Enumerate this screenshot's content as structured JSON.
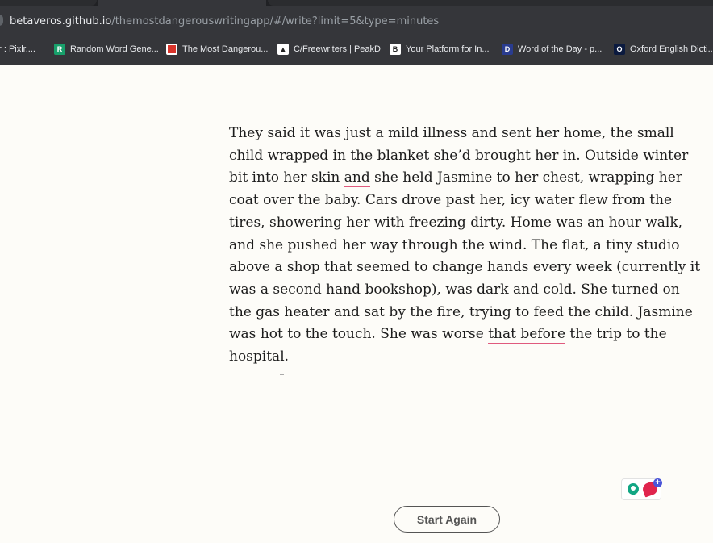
{
  "browser": {
    "url_host": "betaveros.github.io",
    "url_path": "/themostdangerouswritingapp/#/write?limit=5&type=minutes",
    "bookmarks": [
      {
        "label": "or : Pixlr....",
        "icon": "pixlr-icon",
        "color": "#35363a"
      },
      {
        "label": "Random Word Gene...",
        "icon": "random-word-icon",
        "color": "#18a06b",
        "glyph": "R"
      },
      {
        "label": "The Most Dangerou...",
        "icon": "most-dangerous-icon",
        "color": "#d9342b"
      },
      {
        "label": "C/Freewriters | PeakD",
        "icon": "peakd-icon",
        "color": "#ffffff"
      },
      {
        "label": "Your Platform for In...",
        "icon": "platform-icon",
        "color": "#ffffff",
        "glyph": "B"
      },
      {
        "label": "Word of the Day - p...",
        "icon": "word-of-day-icon",
        "color": "#2a3c8f",
        "glyph": "D"
      },
      {
        "label": "Oxford English Dicti...",
        "icon": "oxford-icon",
        "color": "#0b1a3f",
        "glyph": "O"
      }
    ]
  },
  "editor": {
    "lines": [
      [
        {
          "t": "They said it was just a mild illness and sent her home, the small"
        }
      ],
      [
        {
          "t": "child wrapped in the blanket she’d brought her in. Outside "
        },
        {
          "t": "winter",
          "sp": true
        },
        {
          "t": " "
        }
      ],
      [
        {
          "t": "bit into her skin "
        },
        {
          "t": "and",
          "sp": true
        },
        {
          "t": " she held Jasmine to her chest, wrapping her"
        }
      ],
      [
        {
          "t": "coat over the baby. Cars drove past her, icy water flew from the"
        }
      ],
      [
        {
          "t": "tires, showering her with freezing "
        },
        {
          "t": "dirty",
          "sp": true
        },
        {
          "t": ". Home was an "
        },
        {
          "t": "hour",
          "sp": true
        },
        {
          "t": " walk,"
        }
      ],
      [
        {
          "t": "and she pushed her way through the wind. The flat, a tiny studio"
        }
      ],
      [
        {
          "t": "above a shop that seemed to change hands every week (currently it"
        }
      ],
      [
        {
          "t": "was a "
        },
        {
          "t": "second hand",
          "sp": true
        },
        {
          "t": " bookshop), was dark and cold. She turned on"
        }
      ],
      [
        {
          "t": "the gas heater and sat by the fire, trying to feed the child. Jasmine"
        }
      ],
      [
        {
          "t": "was hot to the touch. She was worse "
        },
        {
          "t": "that before",
          "sp": true
        },
        {
          "t": " the trip to the"
        }
      ],
      [
        {
          "t": "hospital."
        }
      ]
    ]
  },
  "actions": {
    "start_again_label": "Start Again"
  },
  "colors": {
    "background": "#fdfcf8",
    "spellcheck_underline": "#e05a7e",
    "grammar_green": "#11a683",
    "grammar_red": "#e0244d"
  }
}
